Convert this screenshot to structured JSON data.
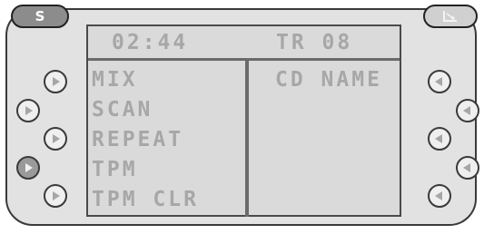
{
  "header": {
    "s_button_label": "S",
    "time": "02:44",
    "track": "TR 08"
  },
  "menu": {
    "items": [
      "MIX",
      "SCAN",
      "REPEAT",
      "TPM",
      "TPM CLR"
    ],
    "right_label": "CD NAME"
  }
}
